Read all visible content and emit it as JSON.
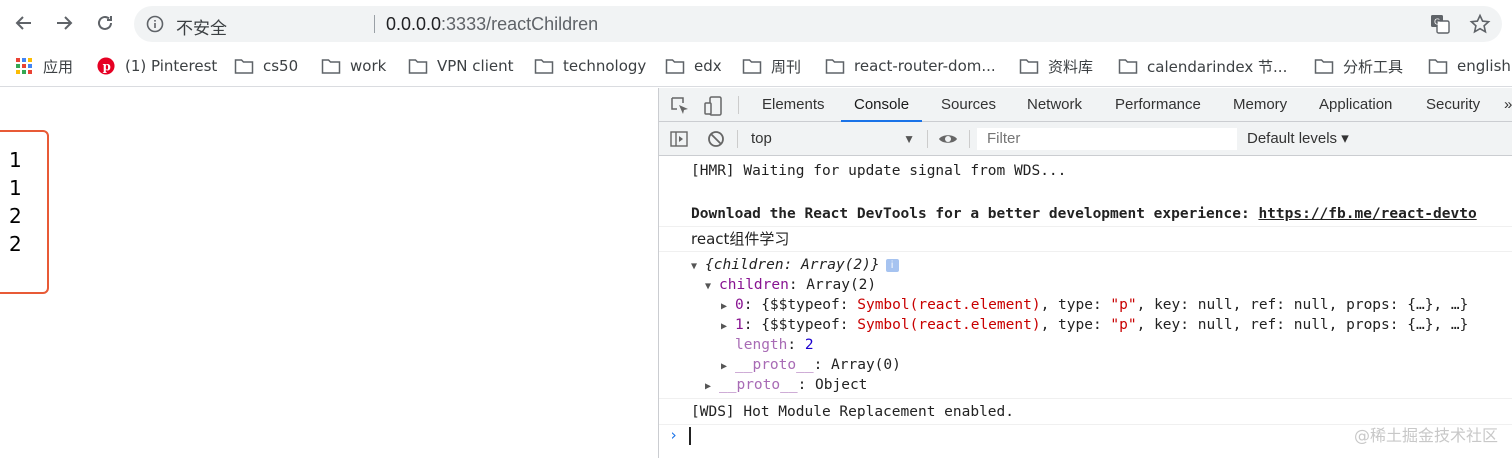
{
  "browser": {
    "security_label": "不安全",
    "url_host": "0.0.0.0",
    "url_path": ":3333/reactChildren"
  },
  "bookmarks": [
    {
      "label": "应用",
      "icon": "apps-grid-icon"
    },
    {
      "label": "(1) Pinterest",
      "icon": "pinterest-icon"
    },
    {
      "label": "cs50",
      "icon": "folder-icon"
    },
    {
      "label": "work",
      "icon": "folder-icon"
    },
    {
      "label": "VPN client",
      "icon": "folder-icon"
    },
    {
      "label": "technology",
      "icon": "folder-icon"
    },
    {
      "label": "edx",
      "icon": "folder-icon"
    },
    {
      "label": "周刊",
      "icon": "folder-icon"
    },
    {
      "label": "react-router-dom...",
      "icon": "folder-icon"
    },
    {
      "label": "资料库",
      "icon": "folder-icon"
    },
    {
      "label": "calendarindex 节...",
      "icon": "folder-icon"
    },
    {
      "label": "分析工具",
      "icon": "folder-icon"
    },
    {
      "label": "english",
      "icon": "folder-icon"
    }
  ],
  "page": {
    "lines": [
      "1",
      "1",
      "2",
      "2"
    ],
    "box_color": "#e85a36"
  },
  "devtools": {
    "tabs": [
      "Elements",
      "Console",
      "Sources",
      "Network",
      "Performance",
      "Memory",
      "Application",
      "Security"
    ],
    "active_tab": "Console",
    "more_tabs_glyph": "»",
    "context": "top",
    "filter_placeholder": "Filter",
    "levels": "Default levels ▾",
    "accent": "#1a73e8"
  },
  "console": {
    "hmr": "[HMR] Waiting for update signal from WDS...",
    "devtools_msg": "Download the React DevTools for a better development experience: ",
    "devtools_link": "https://fb.me/react-devto",
    "log_text": "react组件学习",
    "obj_summary": "{children: Array(2)}",
    "children_key": "children",
    "children_val": ": Array(2)",
    "item0_key": "0",
    "item1_key": "1",
    "item_prefix": ": {$$typeof: ",
    "item_symbol": "Symbol(react.element)",
    "item_type_key": ", type: ",
    "item_type_val": "\"p\"",
    "item_rest": ", key: null, ref: null, props: {…}, …}",
    "length_key": "length",
    "length_val": "2",
    "proto_key": "__proto__",
    "proto_array": ": Array(0)",
    "proto_object": ": Object",
    "wds": "[WDS] Hot Module Replacement enabled.",
    "prompt": "›"
  },
  "watermark": "@稀土掘金技术社区"
}
